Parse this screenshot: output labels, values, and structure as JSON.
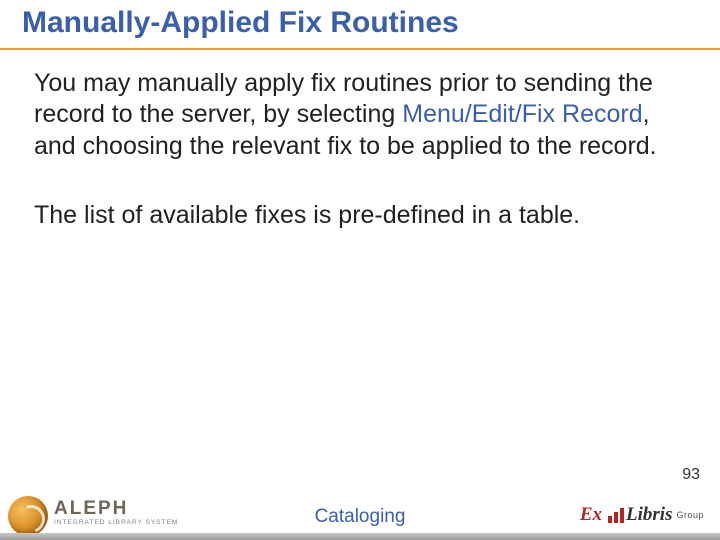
{
  "title": "Manually-Applied Fix Routines",
  "para1_a": "You may manually apply fix routines prior to sending the record to the server, by selecting ",
  "para1_menu": "Menu/Edit/Fix Record",
  "para1_b": ", and choosing the relevant fix to be applied to the record.",
  "para2": "The list of available fixes is pre-defined in a table.",
  "page_number": "93",
  "footer_center": "Cataloging",
  "aleph": {
    "name": "ALEPH",
    "tag": "INTEGRATED LIBRARY SYSTEM"
  },
  "exlibris": {
    "ex": "Ex",
    "libris": "Libris",
    "group": "Group"
  }
}
